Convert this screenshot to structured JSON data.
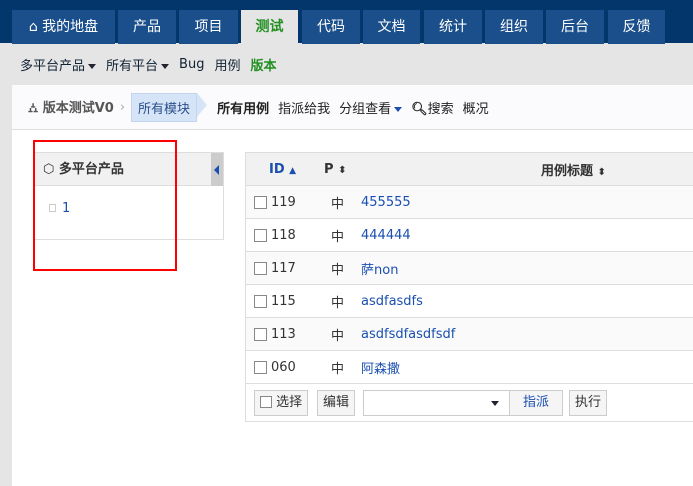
{
  "topnav": {
    "tabs": [
      "我的地盘",
      "产品",
      "项目",
      "测试",
      "代码",
      "文档",
      "统计",
      "组织",
      "后台",
      "反馈"
    ],
    "active": "测试"
  },
  "subnav": {
    "product": "多平台产品",
    "platform": "所有平台",
    "links": [
      "Bug",
      "用例",
      "版本"
    ]
  },
  "breadcrumb": {
    "root": "版本测试V0",
    "module": "所有模块",
    "links": [
      "所有用例",
      "指派给我",
      "分组查看",
      "搜索",
      "概况"
    ]
  },
  "tree": {
    "title": "多平台产品",
    "items": [
      "1"
    ]
  },
  "table": {
    "headers": {
      "id": "ID",
      "pri": "P",
      "title": "用例标题"
    },
    "rows": [
      {
        "id": "119",
        "pri": "中",
        "title": "455555"
      },
      {
        "id": "118",
        "pri": "中",
        "title": "444444"
      },
      {
        "id": "117",
        "pri": "中",
        "title": "萨non"
      },
      {
        "id": "115",
        "pri": "中",
        "title": "asdfasdfs"
      },
      {
        "id": "113",
        "pri": "中",
        "title": "asdfsdfasdfsdf"
      },
      {
        "id": "060",
        "pri": "中",
        "title": "阿森撒"
      }
    ],
    "footer": {
      "select_all": "选择",
      "edit": "编辑",
      "assign": "指派",
      "run": "执行"
    }
  }
}
